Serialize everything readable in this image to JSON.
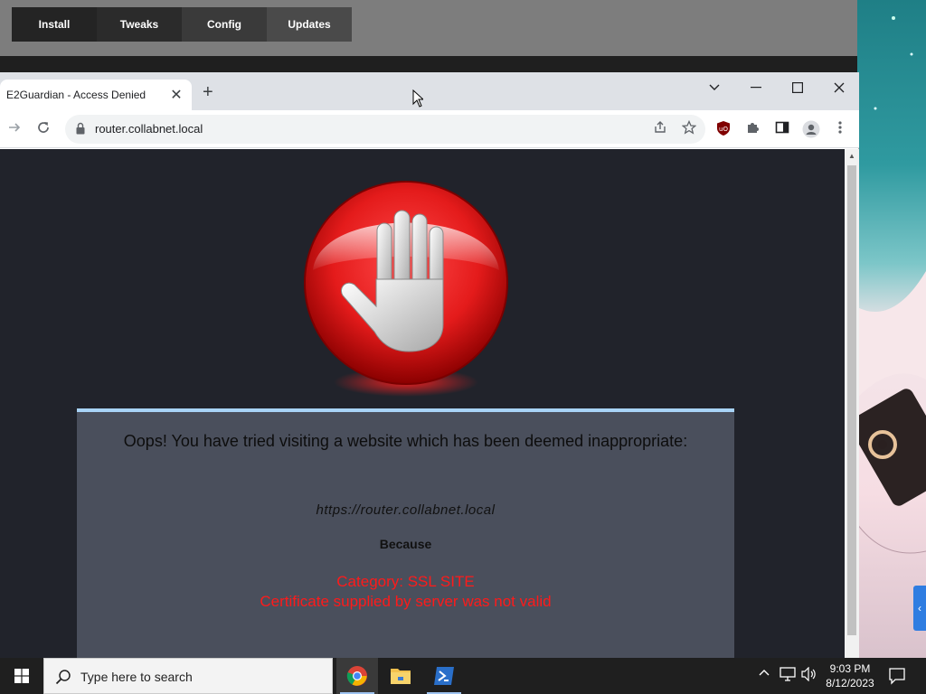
{
  "background_app": {
    "tabs": [
      "Install",
      "Tweaks",
      "Config",
      "Updates"
    ]
  },
  "browser": {
    "tab_title": "E2Guardian - Access Denied",
    "tab_close": "✕",
    "new_tab": "+",
    "url": "router.collabnet.local",
    "window_controls": {
      "dropdown": "⌄",
      "minimize": "–",
      "maximize": "☐",
      "close": "✕"
    }
  },
  "page": {
    "message": "Oops! You have tried visiting a website which has been deemed inappropriate:",
    "blocked_url": "https://router.collabnet.local",
    "because": "Because",
    "category": "Category: SSL SITE",
    "reason": "Certificate supplied by server was not valid"
  },
  "taskbar": {
    "search_placeholder": "Type here to search",
    "time": "9:03 PM",
    "date": "8/12/2023"
  },
  "colors": {
    "page_bg": "#21232b",
    "panel_bg": "#4a4f5c",
    "panel_border": "#a8d3f7",
    "error_red": "#ff1a1a",
    "stop_red": "#e41b1b"
  },
  "icons": {
    "side_tab": "‹"
  }
}
